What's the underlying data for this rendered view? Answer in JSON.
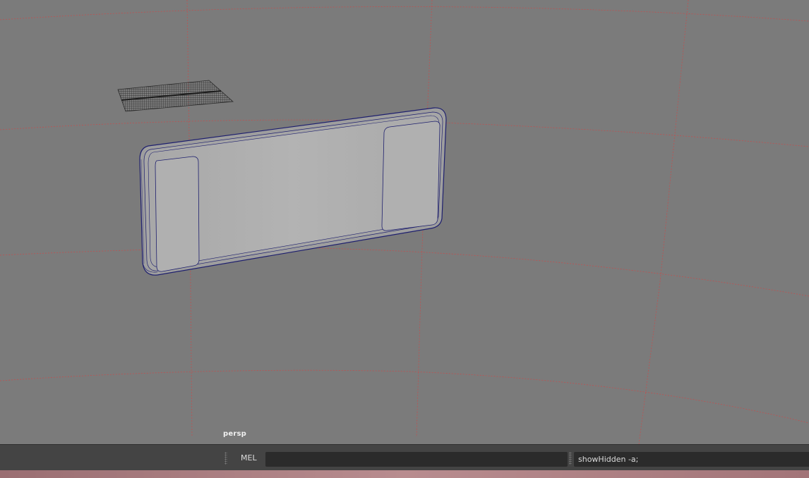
{
  "viewport": {
    "camera_label": "persp",
    "grid_color": "#c84a4a",
    "background_color": "#7b7b7b",
    "wire_color": "#1e1f6e"
  },
  "command_line": {
    "language_label": "MEL",
    "input_value": "",
    "result_text": "showHidden -a;"
  }
}
